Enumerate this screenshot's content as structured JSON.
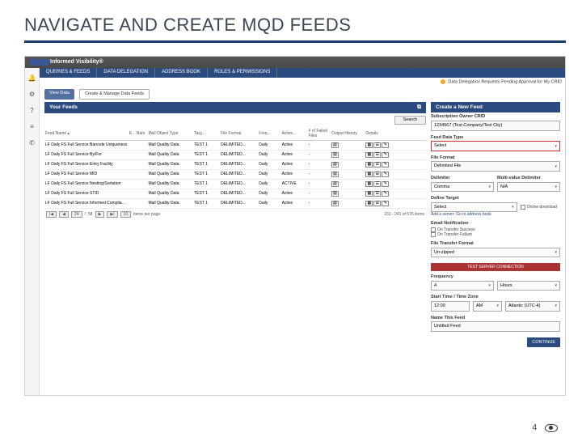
{
  "slide": {
    "title": "NAVIGATE AND CREATE MQD FEEDS",
    "page_number": "4"
  },
  "topbar": {
    "product": "Informed Visibility®"
  },
  "side_icons": [
    "bell",
    "gear",
    "help",
    "lines",
    "phone"
  ],
  "nav": {
    "tabs": [
      "QUERIES & FEEDS",
      "DATA DELEGATION",
      "ADDRESS BOOK",
      "ROLES & PERMISSIONS"
    ]
  },
  "approval_banner": "Data Delegation Requests Pending Approval for My CRID",
  "subnav": {
    "view": "View Data",
    "manage": "Create & Manage Data Feeds"
  },
  "left_panel": {
    "title": "Your Feeds",
    "search": "Search"
  },
  "table": {
    "headers": [
      "Feed Name ▴",
      "E... Nam",
      "Mail Object Type",
      "Targ...",
      "File Format",
      "Freq...",
      "Active...",
      "# of Failed Files",
      "Output History",
      "Details"
    ],
    "rows": [
      [
        "LF Daily FS Full Service Barcode Uniqueness",
        "",
        "Mail Quality Data",
        "TEST 1",
        "DELIMITED...",
        "Daily",
        "Active",
        "-"
      ],
      [
        "LF Daily FS Full Service By/For",
        "",
        "Mail Quality Data",
        "TEST 1",
        "DELIMITED...",
        "Daily",
        "Active",
        "-"
      ],
      [
        "LF Daily FS Full Service Entry Facility",
        "",
        "Mail Quality Data",
        "TEST 1",
        "DELIMITED...",
        "Daily",
        "Active",
        "-"
      ],
      [
        "LF Daily FS Full Service MID",
        "",
        "Mail Quality Data",
        "TEST 1",
        "DELIMITED...",
        "Daily",
        "Active",
        "-"
      ],
      [
        "LF Daily FS Full Service Nesting/Sortation",
        "",
        "Mail Quality Data",
        "TEST 1",
        "DELIMITED...",
        "Daily",
        "ACTIVE",
        "-"
      ],
      [
        "LF Daily FS Full Service STID",
        "",
        "Mail Quality Data",
        "TEST 1",
        "DELIMITED...",
        "Daily",
        "Active",
        "-"
      ],
      [
        "LF Daily FS Full Service Informed Compliance",
        "",
        "Mail Quality Data",
        "TEST 1",
        "DELIMITED...",
        "Daily",
        "Active",
        "-"
      ]
    ]
  },
  "pager": {
    "first": "|◀",
    "prev": "◀",
    "page": "24",
    "sep": "/",
    "total": "58",
    "next": "▶",
    "last": "▶|",
    "per_page_value": "10",
    "per_page_label": "items per page",
    "summary": "231 - 241 of 575 items"
  },
  "right_panel": {
    "title": "Create a New Feed",
    "owner_label": "Subscription Owner CRID",
    "owner_value": "1234567 (Test Company/Test City)",
    "data_type_label": "Feed Data Type",
    "data_type_value": "Select",
    "file_format_label": "File Format",
    "file_format_value": "Delimited File",
    "delimiter_label": "Delimiter",
    "delimiter_value": "Comma",
    "mvd_label": "Multi-value Delimiter",
    "mvd_value": "N/A",
    "target_label": "Define Target",
    "target_value": "Select",
    "online_target": "Online download",
    "add_server_link": "Add a server: Go to address book",
    "email_notif_label": "Email Notification",
    "on_success": "On Transfer Success",
    "on_failure": "On Transfer Failure",
    "transfer_format_label": "File Transfer Format",
    "transfer_format_value": "Un-zipped",
    "test_btn": "TEST SERVER CONNECTION",
    "frequency_label": "Frequency",
    "freq_num": "4",
    "freq_unit": "Hours",
    "start_label": "Start Time / Time Zone",
    "start_time": "12:00",
    "start_ampm": "AM",
    "start_tz": "Atlantic (UTC-4)",
    "name_label": "Name This Feed",
    "name_value": "Untitled Feed",
    "continue": "CONTINUE"
  }
}
